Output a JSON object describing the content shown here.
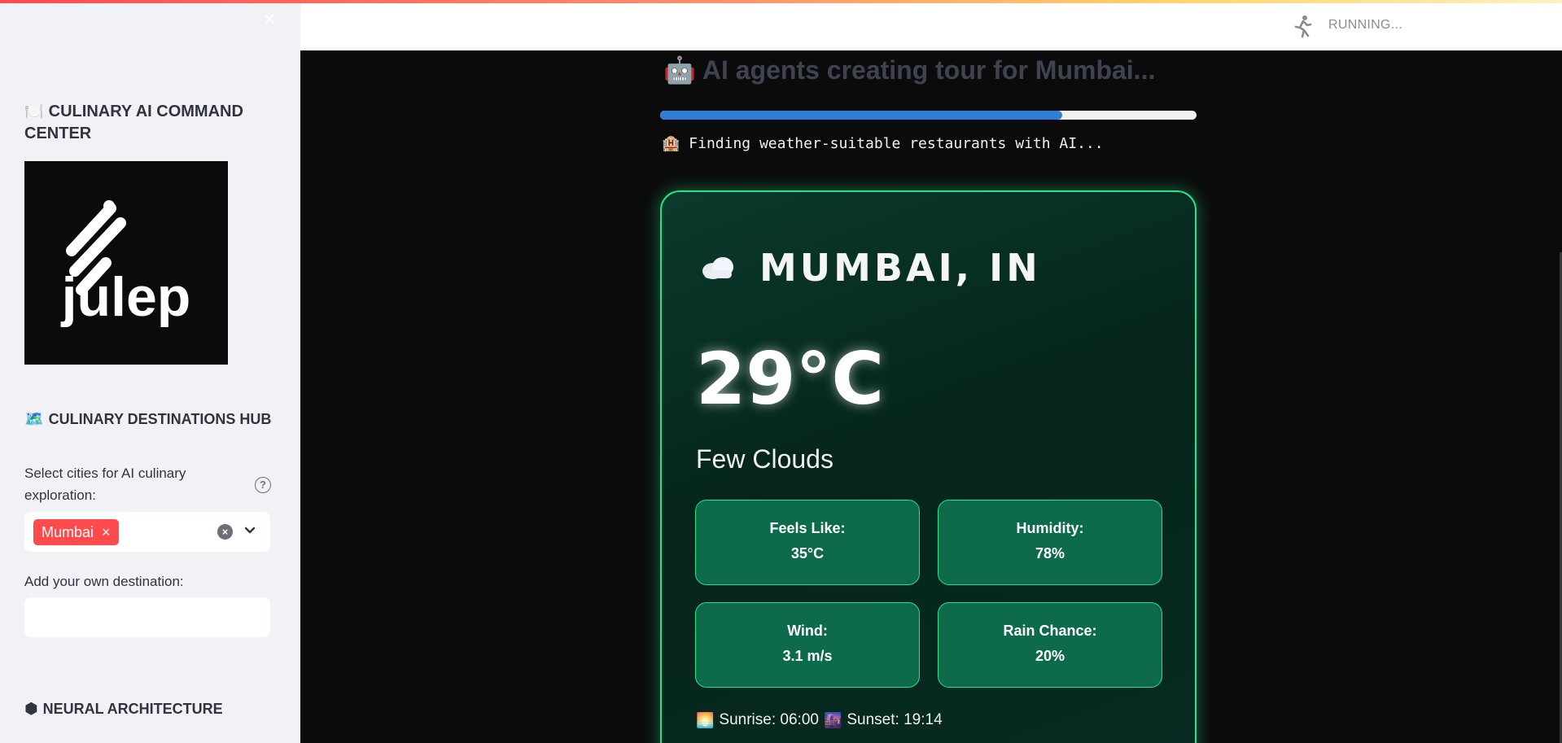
{
  "sidebar": {
    "close_label": "×",
    "title_emoji": "🍽️",
    "title": "CULINARY AI COMMAND CENTER",
    "logo_text": "julep",
    "hub_emoji": "🗺️",
    "hub_title": "CULINARY DESTINATIONS HUB",
    "cities_label": "Select cities for AI culinary exploration:",
    "help_icon": "?",
    "selected_cities": [
      "Mumbai"
    ],
    "chip_remove": "×",
    "own_destination_label": "Add your own destination:",
    "own_destination_value": "",
    "arch_icon": "⬢",
    "arch_title": "NEURAL ARCHITECTURE"
  },
  "header": {
    "status": "RUNNING..."
  },
  "main": {
    "heading_emoji": "🤖",
    "heading": "AI agents creating tour for Mumbai...",
    "progress": 0.75,
    "status_emoji": "🏨",
    "status_text": "Finding weather-suitable restaurants with AI...",
    "weather": {
      "city": "MUMBAI, IN",
      "temperature": "29°C",
      "condition": "Few Clouds",
      "feels_like_label": "Feels Like:",
      "feels_like": "35°C",
      "humidity_label": "Humidity:",
      "humidity": "78%",
      "wind_label": "Wind:",
      "wind": "3.1 m/s",
      "rain_label": "Rain Chance:",
      "rain": "20%",
      "sunrise_emoji": "🌅",
      "sunrise": "Sunrise: 06:00",
      "sunset_emoji": "🌆",
      "sunset": "Sunset: 19:14"
    }
  },
  "colors": {
    "accent_red": "#ff4b4b",
    "progress_blue": "#2f7ed8",
    "card_border_green": "#22e58a"
  }
}
